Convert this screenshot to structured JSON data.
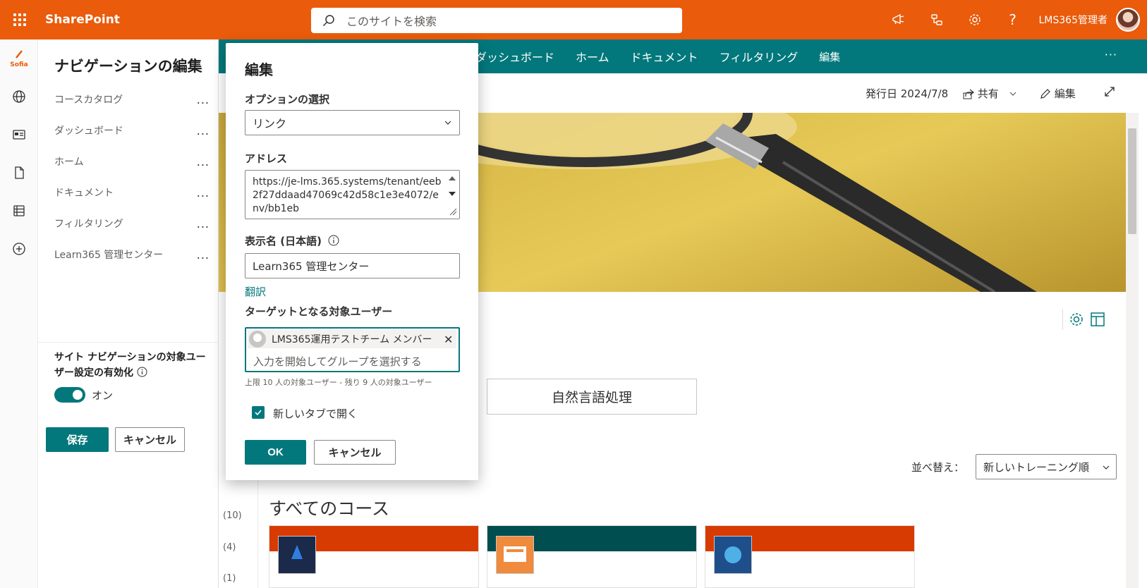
{
  "suite": {
    "brand": "SharePoint",
    "search_placeholder": "このサイトを検索",
    "user_name": "LMS365管理者"
  },
  "appbar": {
    "logo_text": "Sofia"
  },
  "nav_panel": {
    "title": "ナビゲーションの編集",
    "items": [
      {
        "label": "コースカタログ"
      },
      {
        "label": "ダッシュボード"
      },
      {
        "label": "ホーム"
      },
      {
        "label": "ドキュメント"
      },
      {
        "label": "フィルタリング"
      },
      {
        "label": "Learn365 管理センター"
      }
    ],
    "more_glyph": "...",
    "audience_label": "サイト ナビゲーションの対象ユーザー設定の有効化",
    "toggle_label": "オン",
    "save": "保存",
    "cancel": "キャンセル"
  },
  "site_nav": {
    "links": [
      "ダッシュボード",
      "ホーム",
      "ドキュメント",
      "フィルタリング",
      "編集"
    ],
    "more": "···"
  },
  "command_bar": {
    "published": "発行日 2024/7/8",
    "share": "共有",
    "edit": "編集"
  },
  "dialog": {
    "title": "編集",
    "option_label": "オプションの選択",
    "option_value": "リンク",
    "address_label": "アドレス",
    "address_value": "https://je-lms.365.systems/tenant/eeb2f27ddaad47069c42d58c1e3e4072/env/bb1eb",
    "display_name_label": "表示名 (日本語)",
    "display_name_value": "Learn365 管理センター",
    "translate": "翻訳",
    "target_label": "ターゲットとなる対象ユーザー",
    "selected_group": "LMS365運用テストチーム メンバー",
    "picker_placeholder": "入力を開始してグループを選択する",
    "limit_text": "上限 10 人の対象ユーザー - 残り 9 人の対象ユーザー",
    "new_tab_label": "新しいタブで開く",
    "new_tab_checked": true,
    "ok": "OK",
    "cancel": "キャンセル"
  },
  "page": {
    "nlp_button": "自然言語処理",
    "sort_label": "並べ替え：",
    "sort_value": "新しいトレーニング順",
    "all_courses": "すべてのコース",
    "counts": [
      "(10)",
      "(4)",
      "(1)"
    ],
    "card_band_colors": [
      "#d83b01",
      "#004e50",
      "#d83b01"
    ]
  },
  "colors": {
    "suite_bar": "#ea5b0b",
    "accent": "#03787c"
  }
}
